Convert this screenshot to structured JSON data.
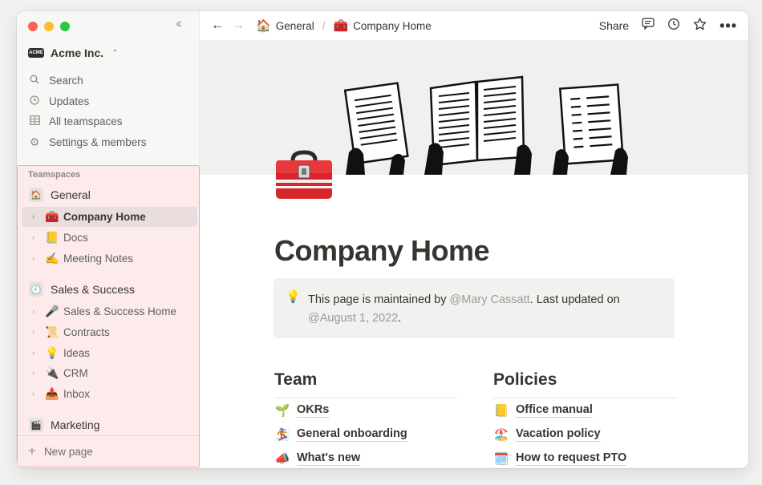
{
  "window": {
    "traffic_colors": [
      "#fe5f57",
      "#febc2e",
      "#28c840"
    ],
    "accent_sidebar_highlight": "#fdebec"
  },
  "sidebar": {
    "workspace_name": "Acme Inc.",
    "workspace_logo": "ACME",
    "nav": [
      {
        "label": "Search",
        "icon": "search-icon"
      },
      {
        "label": "Updates",
        "icon": "clock-icon"
      },
      {
        "label": "All teamspaces",
        "icon": "grid-icon"
      },
      {
        "label": "Settings & members",
        "icon": "gear-icon"
      }
    ],
    "teamspaces_label": "Teamspaces",
    "teams": [
      {
        "label": "General",
        "icon": "home-icon",
        "pages": [
          {
            "label": "Company Home",
            "emoji": "🧰",
            "active": true
          },
          {
            "label": "Docs",
            "emoji": "📒"
          },
          {
            "label": "Meeting Notes",
            "emoji": "✍️"
          }
        ]
      },
      {
        "label": "Sales & Success",
        "icon": "clock-icon",
        "pages": [
          {
            "label": "Sales & Success Home",
            "emoji": "🎤"
          },
          {
            "label": "Contracts",
            "emoji": "📜"
          },
          {
            "label": "Ideas",
            "emoji": "💡"
          },
          {
            "label": "CRM",
            "emoji": "🔌"
          },
          {
            "label": "Inbox",
            "emoji": "📥"
          }
        ]
      },
      {
        "label": "Marketing",
        "icon": "clapper-icon",
        "pages": []
      }
    ],
    "new_page_label": "New page"
  },
  "topbar": {
    "breadcrumb": [
      {
        "label": "General",
        "emoji": "🏠"
      },
      {
        "label": "Company Home",
        "emoji": "🧰"
      }
    ],
    "share_label": "Share"
  },
  "page": {
    "title": "Company Home",
    "icon": "toolbox-icon",
    "callout": {
      "icon": "lightbulb-icon",
      "text_before": "This page is maintained by ",
      "mention_user": "@Mary Cassatt",
      "text_middle": ". Last updated on ",
      "mention_date": "@August 1, 2022",
      "text_after": "."
    },
    "columns": [
      {
        "heading": "Team",
        "items": [
          {
            "label": "OKRs",
            "emoji": "🌱"
          },
          {
            "label": "General onboarding",
            "emoji": "🏂"
          },
          {
            "label": "What's new",
            "emoji": "📣"
          }
        ]
      },
      {
        "heading": "Policies",
        "items": [
          {
            "label": "Office manual",
            "emoji": "📒"
          },
          {
            "label": "Vacation policy",
            "emoji": "🏖️"
          },
          {
            "label": "How to request PTO",
            "emoji": "🗓️"
          }
        ]
      }
    ]
  }
}
